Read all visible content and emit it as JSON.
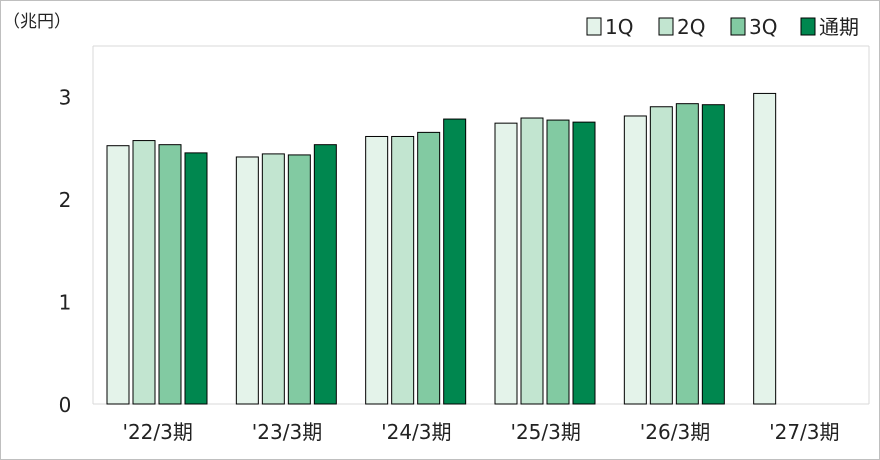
{
  "chart_data": {
    "type": "bar",
    "unit_label": "（兆円）",
    "categories": [
      "'22/3期",
      "'23/3期",
      "'24/3期",
      "'25/3期",
      "'26/3期",
      "'27/3期"
    ],
    "series": [
      {
        "name": "1Q",
        "color": "#e4f3ea",
        "values": [
          2.52,
          2.41,
          2.61,
          2.74,
          2.81,
          3.03
        ]
      },
      {
        "name": "2Q",
        "color": "#c2e5d0",
        "values": [
          2.57,
          2.44,
          2.61,
          2.79,
          2.9,
          null
        ]
      },
      {
        "name": "3Q",
        "color": "#82caa2",
        "values": [
          2.53,
          2.43,
          2.65,
          2.77,
          2.93,
          null
        ]
      },
      {
        "name": "通期",
        "color": "#00874f",
        "values": [
          2.45,
          2.53,
          2.78,
          2.75,
          2.92,
          null
        ]
      }
    ],
    "y_ticks": [
      0,
      1,
      2,
      3
    ],
    "ylim": [
      0,
      3.5
    ],
    "legend_position": "top-right",
    "grid": false,
    "bar_outline_color": "#000000"
  }
}
